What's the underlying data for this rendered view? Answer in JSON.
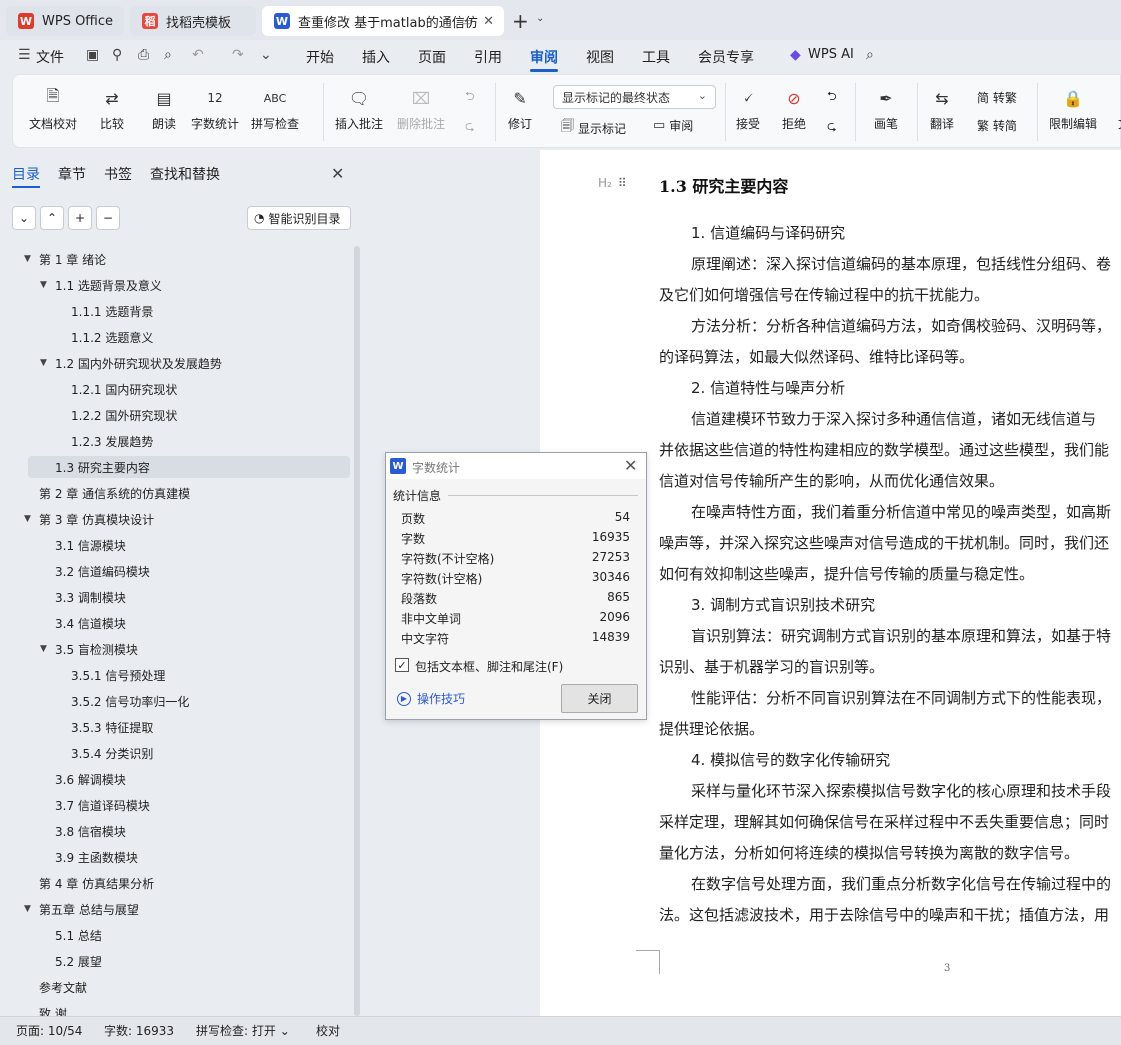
{
  "tabs": [
    {
      "label": "WPS Office",
      "icon": "wps-logo"
    },
    {
      "label": "找稻壳模板",
      "icon": "docer-logo"
    },
    {
      "label": "查重修改 基于matlab的通信仿",
      "icon": "word-doc-icon"
    }
  ],
  "menu": {
    "file": "文件",
    "items": [
      "开始",
      "插入",
      "页面",
      "引用",
      "审阅",
      "视图",
      "工具",
      "会员专享"
    ],
    "active": "审阅",
    "ai": "WPS AI"
  },
  "ribbon": {
    "doc_proof": "文档校对",
    "compare": "比较",
    "read_aloud": "朗读",
    "word_count": "字数统计",
    "spell_check": "拼写检查",
    "insert_comment": "插入批注",
    "delete_comment": "删除批注",
    "revise": "修订",
    "display_select": "显示标记的最终状态",
    "show_marks": "显示标记",
    "review": "审阅",
    "accept": "接受",
    "reject": "拒绝",
    "ink": "画笔",
    "translate": "翻译",
    "to_traditional": "简 转繁",
    "to_simplified": "繁 转简",
    "restrict_edit": "限制编辑",
    "doc_cut": "文"
  },
  "nav": {
    "tabs": [
      "目录",
      "章节",
      "书签",
      "查找和替换"
    ],
    "active_tab": "目录",
    "smart_button": "智能识别目录",
    "toc": [
      {
        "label": "第 1 章  绪论",
        "level": 0,
        "arrow": "▼"
      },
      {
        "label": "1.1 选题背景及意义",
        "level": 1,
        "arrow": "▼"
      },
      {
        "label": "1.1.1 选题背景",
        "level": 2,
        "arrow": ""
      },
      {
        "label": "1.1.2 选题意义",
        "level": 2,
        "arrow": ""
      },
      {
        "label": "1.2 国内外研究现状及发展趋势",
        "level": 1,
        "arrow": "▼"
      },
      {
        "label": "1.2.1 国内研究现状",
        "level": 2,
        "arrow": ""
      },
      {
        "label": "1.2.2 国外研究现状",
        "level": 2,
        "arrow": ""
      },
      {
        "label": "1.2.3 发展趋势",
        "level": 2,
        "arrow": ""
      },
      {
        "label": "1.3 研究主要内容",
        "level": 1,
        "arrow": "",
        "selected": true
      },
      {
        "label": "第 2 章  通信系统的仿真建模",
        "level": 0,
        "arrow": ""
      },
      {
        "label": "第 3 章  仿真模块设计",
        "level": 0,
        "arrow": "▼"
      },
      {
        "label": "3.1 信源模块",
        "level": 1,
        "arrow": ""
      },
      {
        "label": "3.2 信道编码模块",
        "level": 1,
        "arrow": ""
      },
      {
        "label": "3.3 调制模块",
        "level": 1,
        "arrow": ""
      },
      {
        "label": "3.4 信道模块",
        "level": 1,
        "arrow": ""
      },
      {
        "label": "3.5 盲检测模块",
        "level": 1,
        "arrow": "▼"
      },
      {
        "label": "3.5.1 信号预处理",
        "level": 2,
        "arrow": ""
      },
      {
        "label": "3.5.2 信号功率归一化",
        "level": 2,
        "arrow": ""
      },
      {
        "label": "3.5.3 特征提取",
        "level": 2,
        "arrow": ""
      },
      {
        "label": "3.5.4 分类识别",
        "level": 2,
        "arrow": ""
      },
      {
        "label": "3.6  解调模块",
        "level": 1,
        "arrow": ""
      },
      {
        "label": "3.7 信道译码模块",
        "level": 1,
        "arrow": ""
      },
      {
        "label": "3.8 信宿模块",
        "level": 1,
        "arrow": ""
      },
      {
        "label": "3.9  主函数模块",
        "level": 1,
        "arrow": ""
      },
      {
        "label": "第 4 章  仿真结果分析",
        "level": 0,
        "arrow": ""
      },
      {
        "label": "第五章  总结与展望",
        "level": 0,
        "arrow": "▼"
      },
      {
        "label": "5.1 总结",
        "level": 1,
        "arrow": ""
      },
      {
        "label": "5.2 展望",
        "level": 1,
        "arrow": ""
      },
      {
        "label": "参考文献",
        "level": 0,
        "arrow": ""
      },
      {
        "label": "致    谢",
        "level": 0,
        "arrow": ""
      }
    ]
  },
  "doc": {
    "heading_tag": "H₂",
    "heading": "1.3 研究主要内容",
    "lines": [
      "1. 信道编码与译码研究",
      "原理阐述：深入探讨信道编码的基本原理，包括线性分组码、卷",
      "及它们如何增强信号在传输过程中的抗干扰能力。",
      "方法分析：分析各种信道编码方法，如奇偶校验码、汉明码等，",
      "的译码算法，如最大似然译码、维特比译码等。",
      "2. 信道特性与噪声分析",
      "信道建模环节致力于深入探讨多种通信信道，诸如无线信道与",
      "并依据这些信道的特性构建相应的数学模型。通过这些模型，我们能",
      "信道对信号传输所产生的影响，从而优化通信效果。",
      "在噪声特性方面，我们着重分析信道中常见的噪声类型，如高斯",
      "噪声等，并深入探究这些噪声对信号造成的干扰机制。同时，我们还",
      "如何有效抑制这些噪声，提升信号传输的质量与稳定性。",
      "3. 调制方式盲识别技术研究",
      "盲识别算法：研究调制方式盲识别的基本原理和算法，如基于特",
      "识别、基于机器学习的盲识别等。",
      "性能评估：分析不同盲识别算法在不同调制方式下的性能表现，",
      "提供理论依据。",
      "4. 模拟信号的数字化传输研究",
      "采样与量化环节深入探索模拟信号数字化的核心原理和技术手段",
      "采样定理，理解其如何确保信号在采样过程中不丢失重要信息；同时",
      "量化方法，分析如何将连续的模拟信号转换为离散的数字信号。",
      "在数字信号处理方面，我们重点分析数字化信号在传输过程中的",
      "法。这包括滤波技术，用于去除信号中的噪声和干扰；插值方法，用"
    ],
    "page_number": "3"
  },
  "dialog": {
    "title": "字数统计",
    "group": "统计信息",
    "stats": [
      {
        "label": "页数",
        "value": "54"
      },
      {
        "label": "字数",
        "value": "16935"
      },
      {
        "label": "字符数(不计空格)",
        "value": "27253"
      },
      {
        "label": "字符数(计空格)",
        "value": "30346"
      },
      {
        "label": "段落数",
        "value": "865"
      },
      {
        "label": "非中文单词",
        "value": "2096"
      },
      {
        "label": "中文字符",
        "value": "14839"
      }
    ],
    "include_label": "包括文本框、脚注和尾注(F)",
    "include_checked": true,
    "tips": "操作技巧",
    "close": "关闭"
  },
  "status": {
    "page": "页面: 10/54",
    "words": "字数: 16933",
    "spell": "拼写检查: 打开",
    "proof": "校对"
  },
  "colors": {
    "accent": "#1a5fd0",
    "wps_red": "#e03a2f"
  }
}
